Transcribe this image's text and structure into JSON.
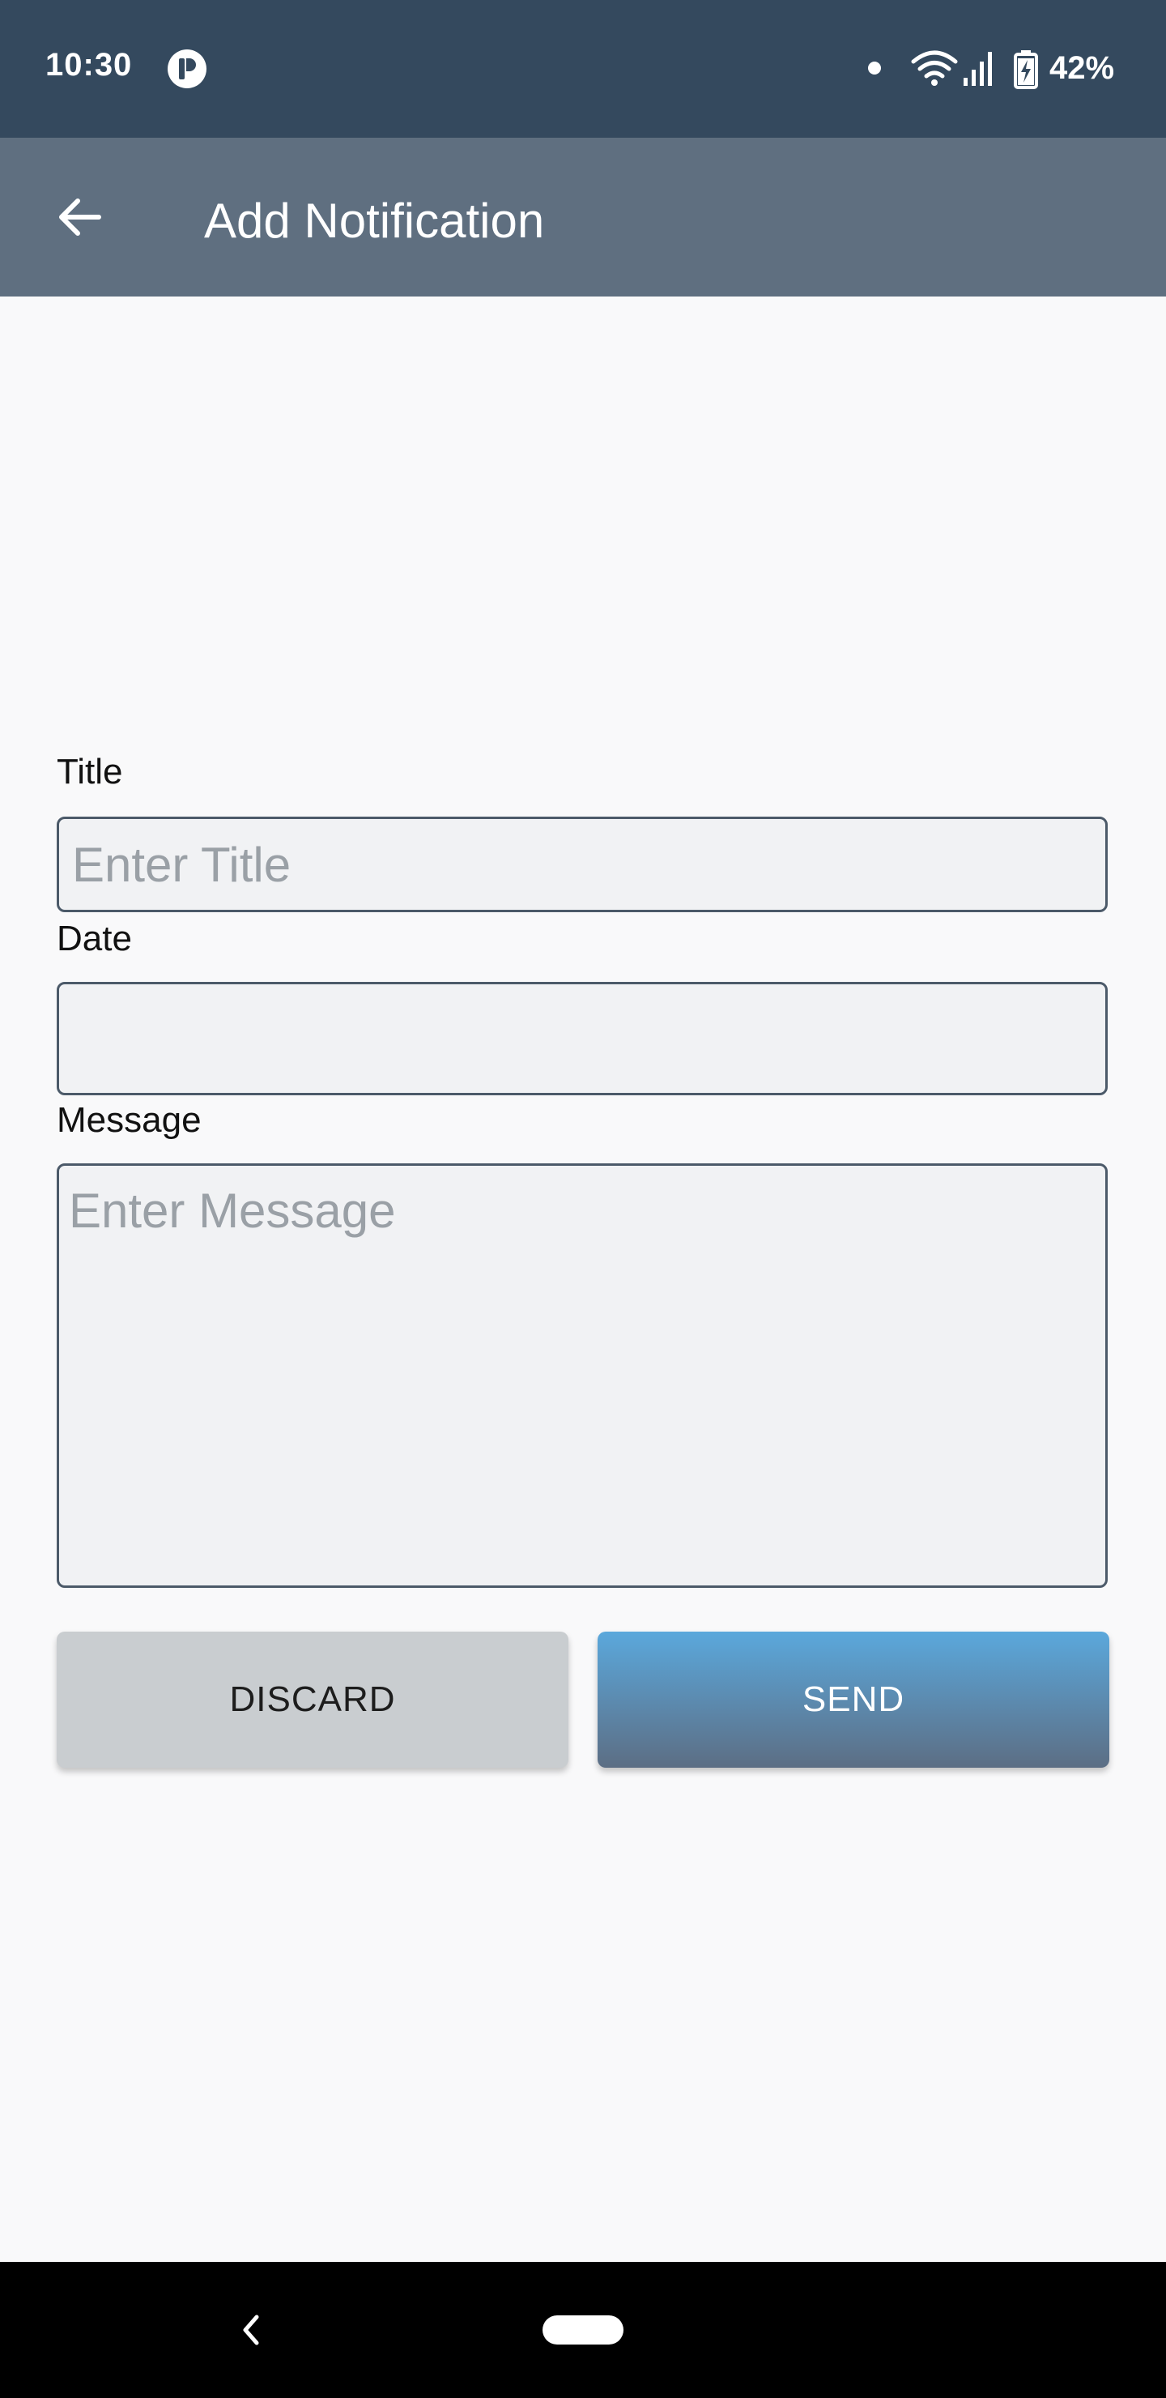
{
  "status_bar": {
    "time": "10:30",
    "battery": "42%",
    "icons": [
      "app-notification-icon",
      "dot-icon",
      "wifi-icon",
      "signal-icon",
      "battery-charging-icon"
    ]
  },
  "app_bar": {
    "title": "Add Notification",
    "back_icon": "arrow-left-icon"
  },
  "form": {
    "title_label": "Title",
    "title_placeholder": "Enter Title",
    "title_value": "",
    "date_label": "Date",
    "date_value": "",
    "message_label": "Message",
    "message_placeholder": "Enter Message",
    "message_value": ""
  },
  "actions": {
    "discard_label": "DISCARD",
    "send_label": "SEND"
  },
  "colors": {
    "status_bar": "#34495e",
    "app_bar": "#5f6f80",
    "send_gradient_top": "#5ba8dc",
    "send_gradient_bottom": "#5c6e84",
    "discard": "#c9cdd0"
  },
  "nav_bar": {
    "icons": [
      "nav-back-icon",
      "nav-home-pill"
    ]
  }
}
